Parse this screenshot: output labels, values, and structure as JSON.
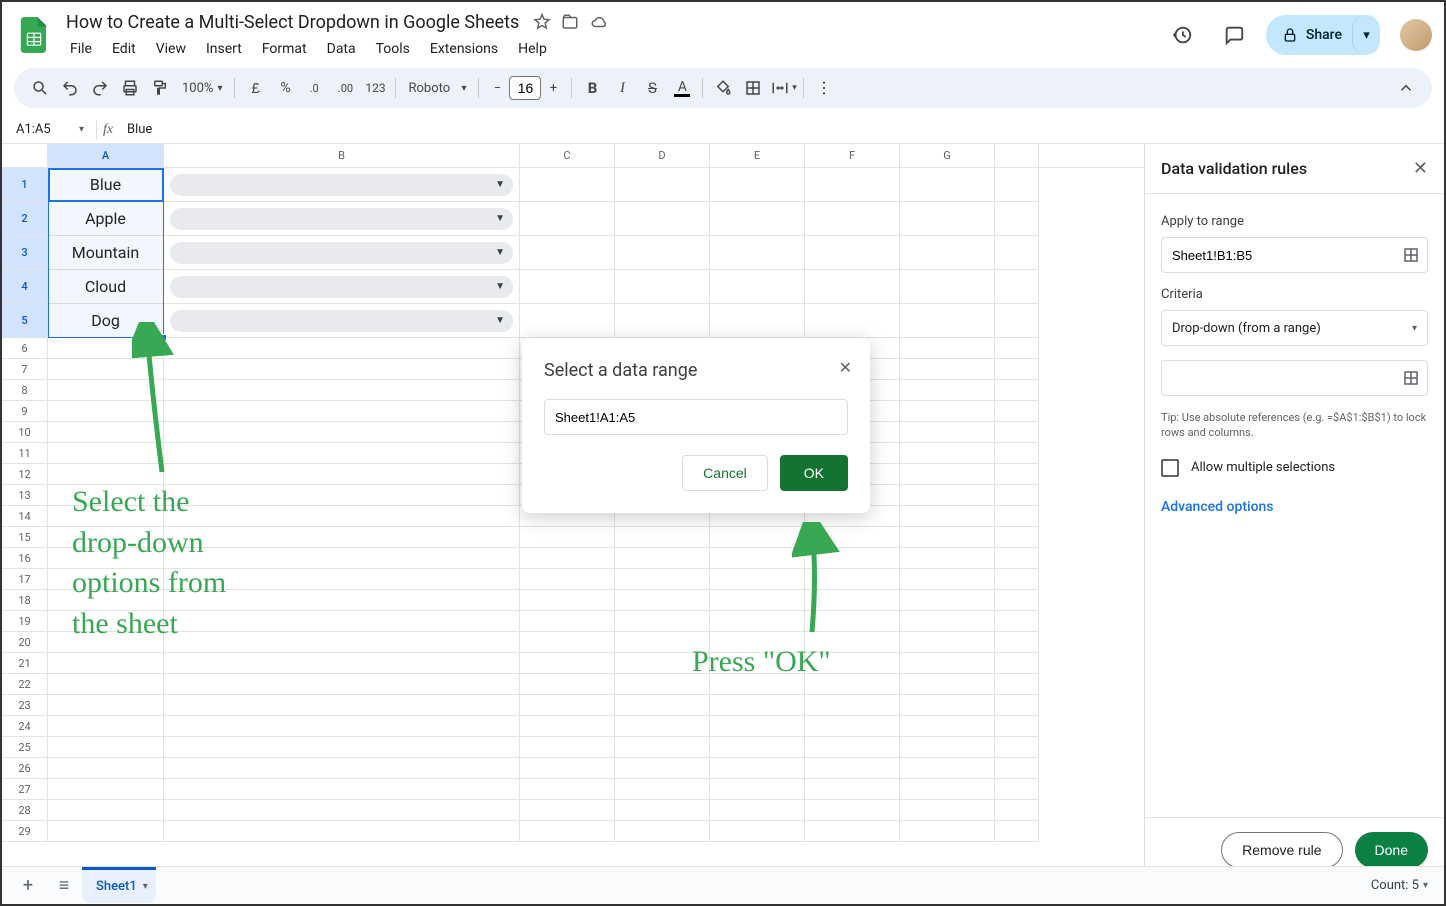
{
  "header": {
    "doc_title": "How to Create a Multi-Select Dropdown in Google Sheets",
    "menus": [
      "File",
      "Edit",
      "View",
      "Insert",
      "Format",
      "Data",
      "Tools",
      "Extensions",
      "Help"
    ],
    "share_label": "Share"
  },
  "toolbar": {
    "zoom": "100%",
    "font": "Roboto",
    "font_size": "16",
    "currency_symbol": "£",
    "percent": "%",
    "precision_label": "123"
  },
  "formula_bar": {
    "name_box": "A1:A5",
    "value": "Blue"
  },
  "grid": {
    "columns": [
      "A",
      "B",
      "C",
      "D",
      "E",
      "F",
      "G"
    ],
    "col_a_values": [
      "Blue",
      "Apple",
      "Mountain",
      "Cloud",
      "Dog"
    ],
    "row_count_visible": 29
  },
  "sidebar": {
    "title": "Data validation rules",
    "apply_label": "Apply to range",
    "apply_value": "Sheet1!B1:B5",
    "criteria_label": "Criteria",
    "criteria_value": "Drop-down (from a range)",
    "range_value": "",
    "tip": "Tip: Use absolute references (e.g. =$A$1:$B$1) to lock rows and columns.",
    "allow_multi_label": "Allow multiple selections",
    "advanced_label": "Advanced options",
    "remove_label": "Remove rule",
    "done_label": "Done"
  },
  "modal": {
    "title": "Select a data range",
    "input_value": "Sheet1!A1:A5",
    "cancel": "Cancel",
    "ok": "OK"
  },
  "sheet_tabs": {
    "tab1": "Sheet1"
  },
  "status": {
    "count_label": "Count: 5"
  },
  "annotations": {
    "left": "Select the\ndrop-down\noptions from\nthe sheet",
    "right": "Press \"OK\""
  }
}
